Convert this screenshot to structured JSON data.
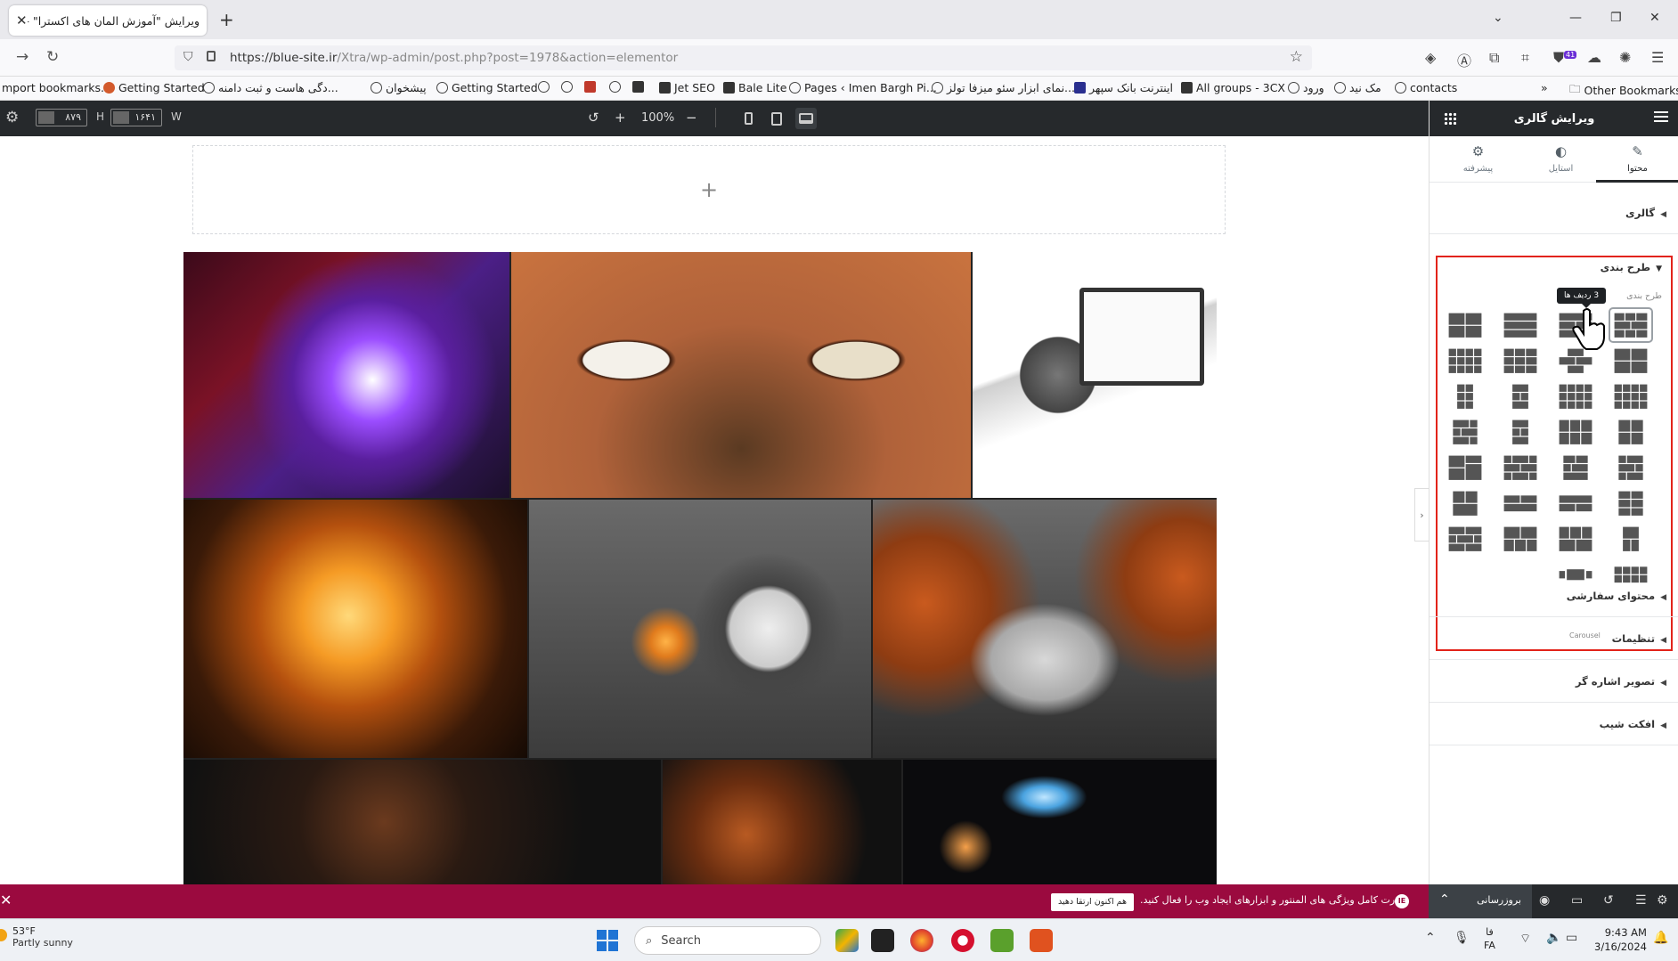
{
  "browser": {
    "tab_title": "ویرایش \"آموزش المان های اکسترا\" – ...",
    "url": "https://blue-site.ir/Xtra/wp-admin/post.php?post=1978&action=elementor",
    "url_host": "https://blue-site.ir",
    "url_path": "/Xtra/wp-admin/post.php?post=1978&action=elementor",
    "extension_badge": "41",
    "bookmarks": [
      "mport bookmarks...",
      "Getting Started",
      "دگی هاست و ثبت دامنه...",
      "پیشخوان",
      "Getting Started",
      "Jet SEO",
      "Bale Lite",
      "Pages ‹ Imen Bargh Pi...",
      "نمای ابزار سئو میزفا تولز...",
      "اینترنت بانک سپهر",
      "All groups - 3CX",
      "ورود",
      "مک نید",
      "contacts"
    ],
    "other_bookmarks": "Other Bookmarks"
  },
  "editor_top": {
    "height_value": "۸۷۹",
    "height_label": "H",
    "width_value": "۱۶۴۱",
    "width_label": "W",
    "zoom": "100%"
  },
  "canvas": {
    "add_section": "+"
  },
  "panel": {
    "title": "ویرایش گالری",
    "tabs": [
      {
        "label": "محتوا",
        "icon": "pencil-icon"
      },
      {
        "label": "استایل",
        "icon": "half-circle-icon"
      },
      {
        "label": "پیشرفته",
        "icon": "gear-icon"
      }
    ],
    "sections": {
      "gallery": "گالری",
      "layout": "طرح بندی",
      "custom_content": "محتوای سفارشی",
      "settings": "تنظیمات",
      "pointer_image": "تصویر اشاره گر",
      "tilt_effect": "افکت شیب"
    },
    "layout_sub_label": "طرح بندی",
    "tooltip": "3 ردیف ها",
    "carousel_label": "Carousel"
  },
  "bottom_bar": {
    "promo_text": "قدرت کامل ویژگی های المنتور و ابزارهای ایجاد وب را فعال کنید.",
    "promo_button": "هم اکنون ارتقا دهید",
    "promo_logo": "IE",
    "update_button": "بروزرسانی"
  },
  "taskbar": {
    "temperature": "53°F",
    "weather": "Partly sunny",
    "search_placeholder": "Search",
    "lang_top": "فا",
    "lang_bottom": "FA",
    "time": "9:43 AM",
    "date": "3/16/2024"
  }
}
